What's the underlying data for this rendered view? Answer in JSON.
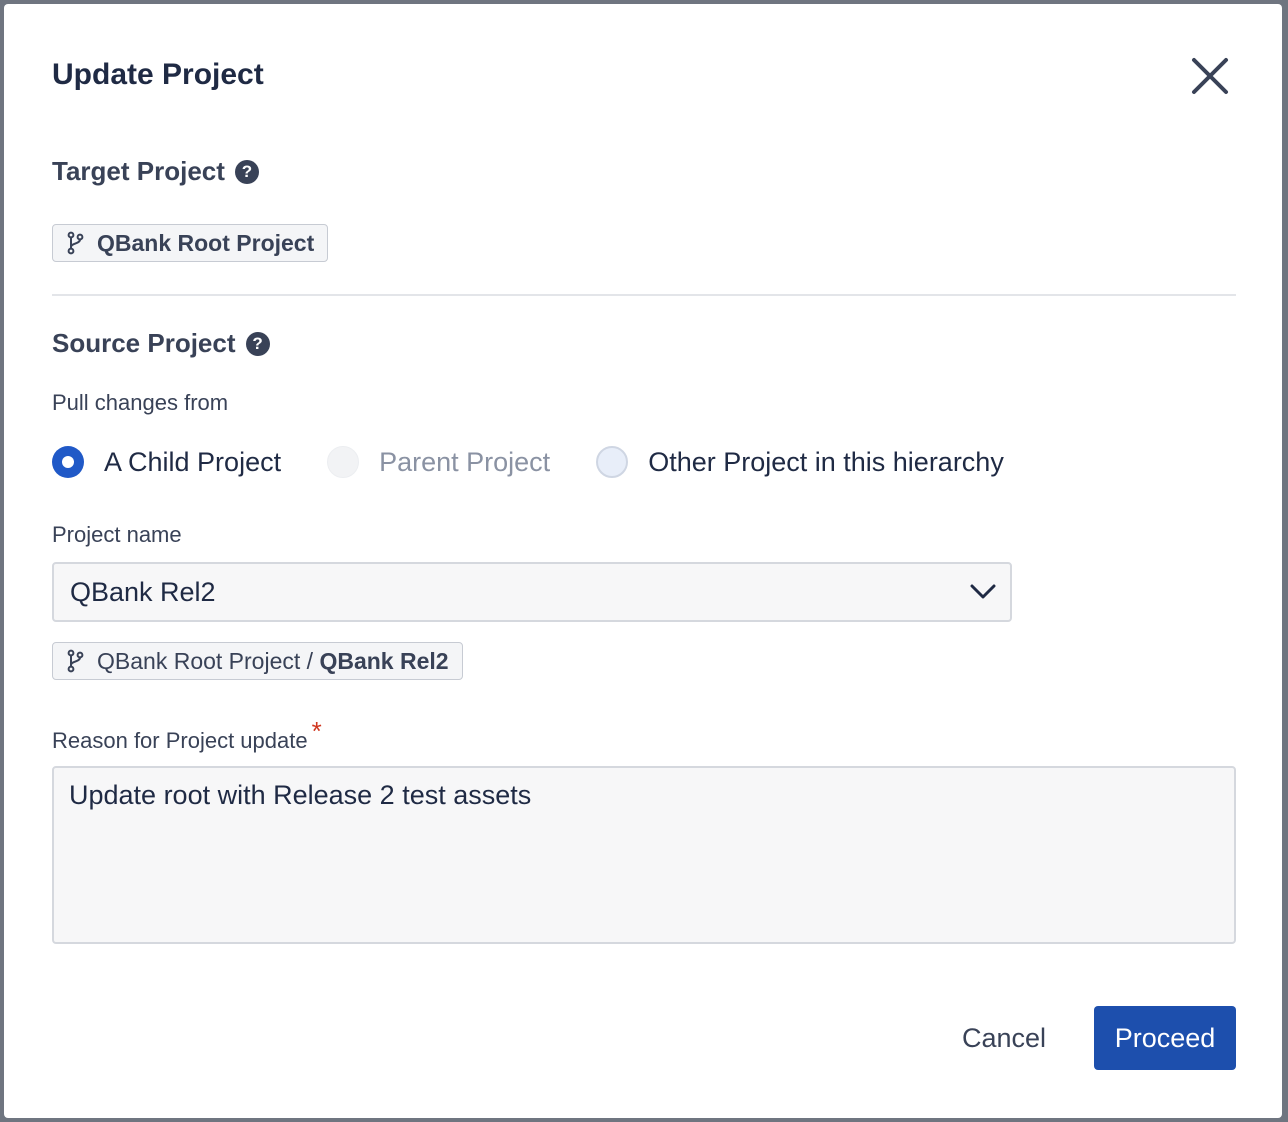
{
  "dialog": {
    "title": "Update Project",
    "close_icon": "close-icon"
  },
  "target": {
    "label": "Target Project",
    "help_icon": "question-circle-icon",
    "chip_icon": "branch-icon",
    "chip_text": "QBank Root Project"
  },
  "source": {
    "label": "Source Project",
    "help_icon": "question-circle-icon",
    "pull_label": "Pull changes from",
    "options": [
      {
        "label": "A Child Project",
        "state": "checked"
      },
      {
        "label": "Parent Project",
        "state": "disabled"
      },
      {
        "label": "Other Project in this hierarchy",
        "state": "unchecked"
      }
    ],
    "project_name_label": "Project name",
    "project_name_value": "QBank Rel2",
    "dropdown_icon": "chevron-down-icon",
    "path_chip": {
      "icon": "branch-icon",
      "prefix": "QBank Root Project / ",
      "current": "QBank Rel2"
    }
  },
  "reason": {
    "label": "Reason for Project update",
    "required_marker": "*",
    "value": "Update root with Release 2 test assets"
  },
  "footer": {
    "cancel_label": "Cancel",
    "proceed_label": "Proceed"
  },
  "colors": {
    "primary": "#1d4fad",
    "radio_checked": "#2059c7",
    "required": "#d0361f",
    "text_dark": "#1f2a44"
  }
}
